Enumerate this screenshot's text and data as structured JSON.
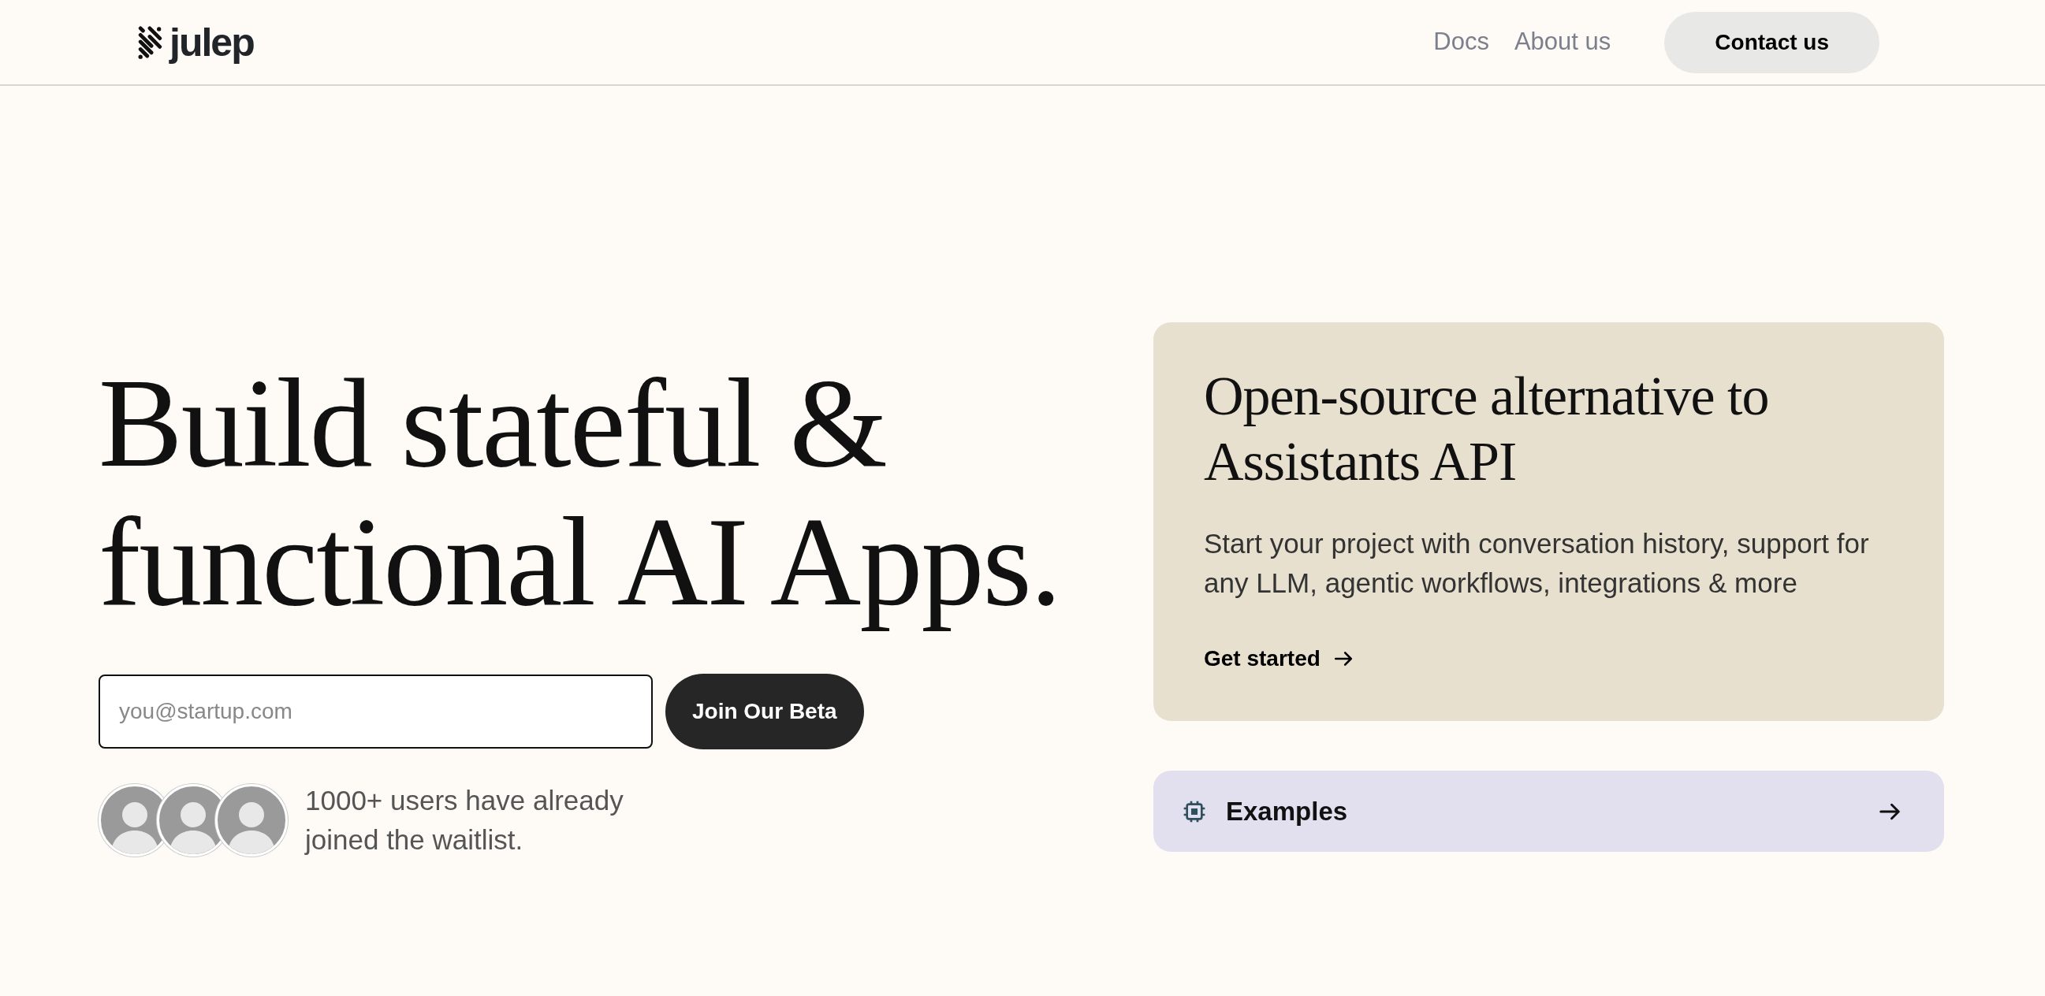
{
  "header": {
    "logo_text": "julep",
    "nav_links": [
      {
        "label": "Docs"
      },
      {
        "label": "About us"
      }
    ],
    "contact_button": "Contact us"
  },
  "hero": {
    "headline_lines": [
      "Build stateful &",
      "functional AI Apps."
    ],
    "email_field": {
      "placeholder": "you@startup.com"
    },
    "join_button": "Join Our Beta",
    "avatar_count_text": "1000+ users have already joined the waitlist.",
    "avatars": [
      {
        "kind": "photo"
      },
      {
        "kind": "photo"
      },
      {
        "kind": "photo"
      }
    ]
  },
  "feature_card": {
    "title": "Open-source alternative to Assistants API",
    "description": "Start your project with conversation history, support for any LLM, agentic workflows, integrations & more",
    "link": "Get started"
  },
  "examples_card": {
    "label": "Examples"
  }
}
